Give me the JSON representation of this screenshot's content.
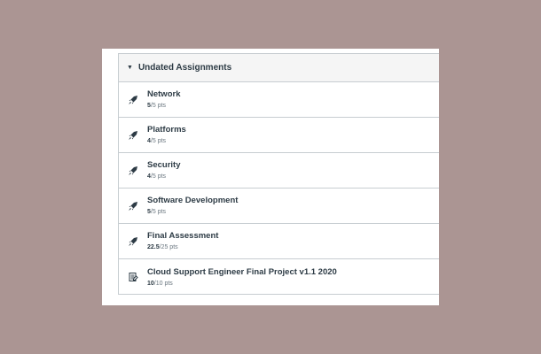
{
  "group": {
    "title": "Undated Assignments",
    "caret_icon": "caret-down-icon"
  },
  "assignments": [
    {
      "title": "Network",
      "score": "5",
      "total": "/5 pts",
      "icon": "rocket-icon"
    },
    {
      "title": "Platforms",
      "score": "4",
      "total": "/5 pts",
      "icon": "rocket-icon"
    },
    {
      "title": "Security",
      "score": "4",
      "total": "/5 pts",
      "icon": "rocket-icon"
    },
    {
      "title": "Software Development",
      "score": "5",
      "total": "/5 pts",
      "icon": "rocket-icon"
    },
    {
      "title": "Final Assessment",
      "score": "22.5",
      "total": "/25 pts",
      "icon": "rocket-icon"
    },
    {
      "title": "Cloud Support Engineer Final Project v1.1 2020",
      "score": "10",
      "total": "/10 pts",
      "icon": "assignment-icon"
    }
  ],
  "colors": {
    "background": "#ab9593",
    "text": "#2d3b45",
    "border": "#c7cdd1",
    "header_bg": "#f5f5f5"
  }
}
